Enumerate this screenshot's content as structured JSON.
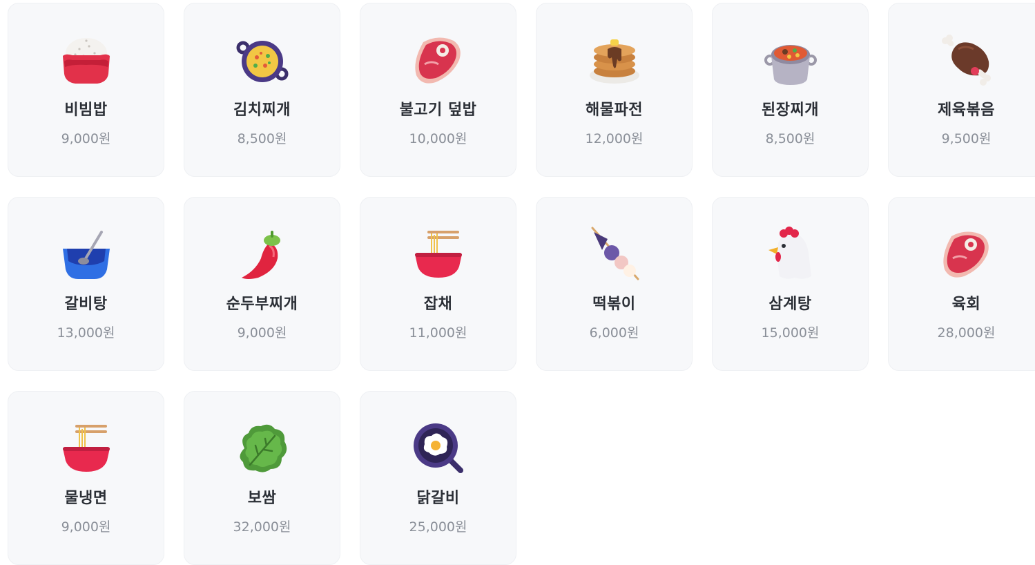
{
  "menu": {
    "items": [
      {
        "name": "비빔밥",
        "price": "9,000원",
        "icon": "rice-bowl-icon"
      },
      {
        "name": "김치찌개",
        "price": "8,500원",
        "icon": "paella-pan-icon"
      },
      {
        "name": "불고기 덮밥",
        "price": "10,000원",
        "icon": "cut-of-meat-icon"
      },
      {
        "name": "해물파전",
        "price": "12,000원",
        "icon": "pancakes-icon"
      },
      {
        "name": "된장찌개",
        "price": "8,500원",
        "icon": "pot-of-food-icon"
      },
      {
        "name": "제육볶음",
        "price": "9,500원",
        "icon": "meat-on-bone-icon"
      },
      {
        "name": "갈비탕",
        "price": "13,000원",
        "icon": "bowl-with-spoon-icon"
      },
      {
        "name": "순두부찌개",
        "price": "9,000원",
        "icon": "hot-pepper-icon"
      },
      {
        "name": "잡채",
        "price": "11,000원",
        "icon": "noodle-bowl-icon"
      },
      {
        "name": "떡볶이",
        "price": "6,000원",
        "icon": "oden-skewer-icon"
      },
      {
        "name": "삼계탕",
        "price": "15,000원",
        "icon": "chicken-icon"
      },
      {
        "name": "육회",
        "price": "28,000원",
        "icon": "cut-of-meat-icon"
      },
      {
        "name": "물냉면",
        "price": "9,000원",
        "icon": "noodle-bowl-icon"
      },
      {
        "name": "보쌈",
        "price": "32,000원",
        "icon": "leafy-green-icon"
      },
      {
        "name": "닭갈비",
        "price": "25,000원",
        "icon": "frying-pan-egg-icon"
      }
    ]
  },
  "colors": {
    "card_background": "#f7f8fa",
    "card_border": "#eef0f3",
    "name_text": "#2b2f36",
    "price_text": "#8a8f98"
  }
}
